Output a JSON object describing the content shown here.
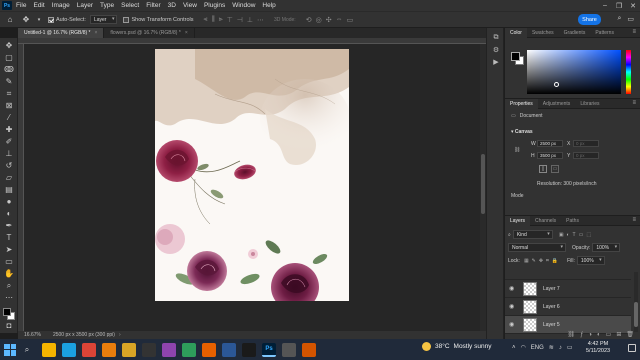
{
  "menubar": {
    "logo": "Ps",
    "items": [
      "File",
      "Edit",
      "Image",
      "Layer",
      "Type",
      "Select",
      "Filter",
      "3D",
      "View",
      "Plugins",
      "Window",
      "Help"
    ],
    "window_controls": [
      "–",
      "❐",
      "✕"
    ]
  },
  "options": {
    "auto_select_label": "Auto-Select:",
    "auto_select_value": "Layer",
    "transform_controls_label": "Show Transform Controls",
    "mode3d_label": "3D Mode:",
    "share_label": "Share"
  },
  "tabs": [
    {
      "label": "Untitled-1 @ 16.7% (RGB/8) *"
    },
    {
      "label": "flowers.psd @ 16.7% (RGB/8) *"
    }
  ],
  "status": {
    "zoom": "16.67%",
    "doc_info": "2500 px x 3500 px (300 ppi)",
    "arrow": "›"
  },
  "color_panel": {
    "tabs": [
      "Color",
      "Swatches",
      "Gradients",
      "Patterns"
    ],
    "foreground": "#000000",
    "background": "#ffffff"
  },
  "properties_panel": {
    "tabs": [
      "Properties",
      "Adjustments",
      "Libraries"
    ],
    "doc_label": "Document",
    "canvas_title": "Canvas",
    "w_label": "W",
    "w_value": "2500 px",
    "h_label": "H",
    "h_value": "3500 px",
    "x_label": "X",
    "x_value": "0 px",
    "y_label": "Y",
    "y_value": "0 px",
    "resolution": "Resolution: 300 pixels/inch",
    "mode": "Mode"
  },
  "layers_panel": {
    "tabs": [
      "Layers",
      "Channels",
      "Paths"
    ],
    "kind_label": "Kind",
    "blend_mode": "Normal",
    "opacity_label": "Opacity:",
    "opacity_value": "100%",
    "lock_label": "Lock:",
    "fill_label": "Fill:",
    "fill_value": "100%",
    "layers": [
      {
        "name": "Layer 7",
        "selected": false
      },
      {
        "name": "Layer 6",
        "selected": false
      },
      {
        "name": "Layer 5",
        "selected": true
      }
    ]
  },
  "taskbar": {
    "weather_temp": "38°C",
    "weather_text": "Mostly sunny",
    "language": "ENG",
    "time": "4:42 PM",
    "date": "5/11/2023",
    "apps": [
      {
        "name": "file-explorer",
        "color": "#f4b400",
        "glyph": ""
      },
      {
        "name": "edge",
        "color": "#1ba1e2",
        "glyph": ""
      },
      {
        "name": "chrome",
        "color": "#db4437",
        "glyph": ""
      },
      {
        "name": "vlc",
        "color": "#e87d0d",
        "glyph": ""
      },
      {
        "name": "files",
        "color": "#d9a526",
        "glyph": ""
      },
      {
        "name": "terminal",
        "color": "#333333",
        "glyph": ""
      },
      {
        "name": "app-purple",
        "color": "#8e44ad",
        "glyph": ""
      },
      {
        "name": "app-green",
        "color": "#2e9e5b",
        "glyph": ""
      },
      {
        "name": "firefox",
        "color": "#e66000",
        "glyph": ""
      },
      {
        "name": "app-blue",
        "color": "#2b5797",
        "glyph": ""
      },
      {
        "name": "app-dark",
        "color": "#1a1a1a",
        "glyph": ""
      },
      {
        "name": "photoshop",
        "color": "#001e36",
        "glyph": "Ps"
      },
      {
        "name": "app-gray",
        "color": "#555555",
        "glyph": ""
      },
      {
        "name": "app-orange",
        "color": "#d35400",
        "glyph": ""
      }
    ]
  },
  "colors": {
    "accent": "#1473e6",
    "panel_bg": "#323232",
    "canvas_bg": "#262626"
  }
}
